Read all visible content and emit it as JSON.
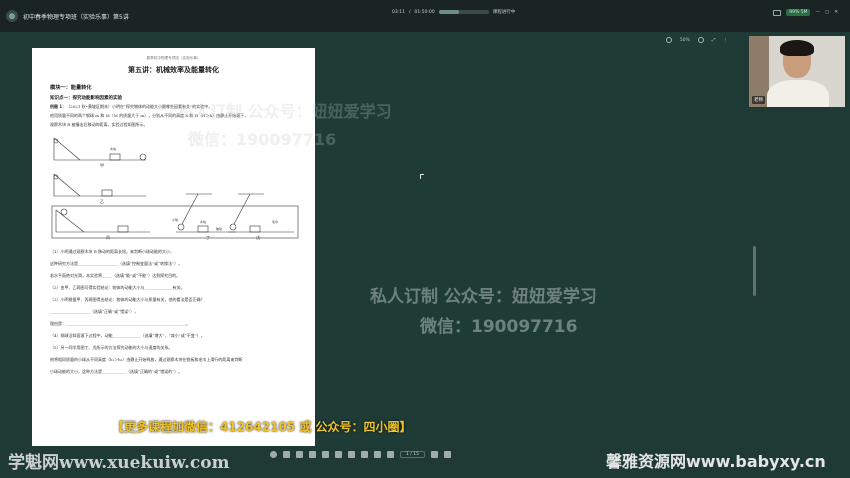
{
  "topbar": {
    "title": "初中春季物理专项班（实验乐事）第5讲",
    "time_current": "03:11",
    "time_total": "01:50:00",
    "progress": 0.4,
    "status_text": "课程进行中",
    "network": "99% 5M"
  },
  "stage_toolbar": {
    "zoom": "50%"
  },
  "document": {
    "header": "春季初中物理专项班（实验乐事）",
    "title": "第五讲：机械效率及能量转化",
    "module": "模块一：能量转化",
    "knowledge_point": "知识点一：探究动能影响因素的实验",
    "example_label": "例题 1：",
    "example_text": "（2021 秋•黄坡区期末）小明在“探究物体的动能大小跟哪些因素有关”的实验中，",
    "para2": "他用质量不同的两个钢球 m 和 M（M 的质量大于 m），分别从不同的高度 h 和 H（H＞h）由静止开始滚下，",
    "para3": "观察木块 B 被撞击后移动的距离，实验过程如图所示。",
    "fig_labels": [
      "甲",
      "乙",
      "丙",
      "丁",
      "戊"
    ],
    "fig_small_labels": [
      "木块",
      "小球",
      "木块",
      "玻璃",
      "毛巾"
    ],
    "q1": "（1）小明通过观察木块 B 移动的距离长短，来判断小球动能的大小，",
    "q1b": "这种研究方法是____________________（选填“控制变量法”或“转换法”）。",
    "q1c": "若水平面绝对光滑，本实验将_____（选填“能”或“不能”）达到探究目的。",
    "q2": "（2）由甲、乙两图可得实验结论：物体的动能大小与______________有关。",
    "q3": "（3）小明根据甲、丙两图得出结论：物体的动能大小与质量有关，他的看法是否正确？",
    "q3b": "____________________（选填“正确”或“错误”），",
    "q3c": "理由是：____________________________________________________________。",
    "q4": "（4）钢球沿斜面滚下过程中，动能______________（选填“增大”、“减小”或“不变”）。",
    "q5": "（5）另一同学用图丁、戊所示的方法探究动能的大小与速度的关系。",
    "q5b": "他将相同质量的小球从不同高度（h₁＞h₂）由静止开始释放，通过观察木块在铁板和毛巾上滑行的距离来判断",
    "q5c": "小球动能的大小，这种方法是____________（选填“正确的”或“错误的”）。"
  },
  "watermarks": {
    "line1": "私人订制 公众号：妞妞爱学习",
    "line2": "微信：190097716"
  },
  "promo": "【更多课程加微信：412642105 或 公众号：四小圈】",
  "bottom": {
    "page_indicator": "1 / 15",
    "site_left": "学魁网www.xuekuiw.com",
    "site_right": "馨雅资源网www.babyxy.cn"
  },
  "webcam": {
    "name_tag": "老师"
  }
}
